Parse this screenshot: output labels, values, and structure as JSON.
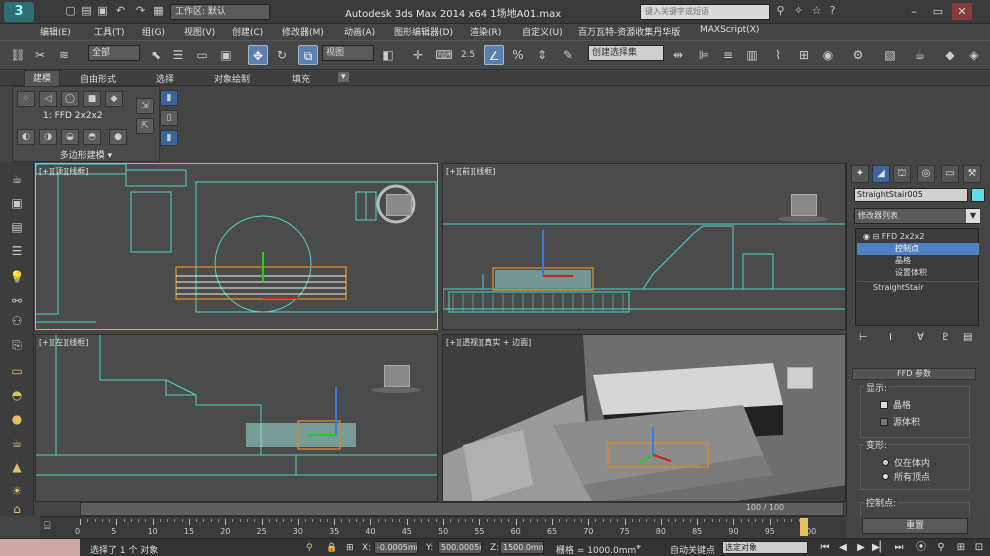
{
  "titlebar": {
    "logo": "3",
    "workspace": "工作区: 默认",
    "title": "Autodesk 3ds Max  2014 x64          1场地A01.max",
    "search_placeholder": "键入关键字或短语"
  },
  "menus": [
    "编辑(E)",
    "工具(T)",
    "组(G)",
    "视图(V)",
    "创建(C)",
    "修改器(M)",
    "动画(A)",
    "图形编辑器(D)",
    "渲染(R)",
    "自定义(U)",
    "百万瓦特-资源收集丹华版",
    "MAXScript(X)"
  ],
  "toolbar": {
    "selection_filter": "全部",
    "ref_coord": "视图",
    "snap_value": "2.5",
    "named_selection": "创建选择集"
  },
  "ribbon": {
    "tabs": [
      "建模",
      "自由形式",
      "选择",
      "对象绘制",
      "填充"
    ],
    "ffd_label": "1: FFD 2x2x2",
    "caption": "多边形建模"
  },
  "viewports": {
    "top": "[+][顶][线框]",
    "front": "[+][前][线框]",
    "left": "[+][左][线框]",
    "persp": "[+][透视][真实 + 边面]"
  },
  "command_panel": {
    "object_name": "StraightStair005",
    "object_color": "#66d9e8",
    "modifier_list": "修改器列表",
    "stack": [
      "FFD 2x2x2",
      "控制点",
      "晶格",
      "设置体积",
      "StraightStair"
    ],
    "rollout": "FFD 参数",
    "display_title": "显示:",
    "lattice": "晶格",
    "source_volume": "源体积",
    "deform_title": "变形:",
    "only_in_volume": "仅在体内",
    "all_vertices": "所有顶点",
    "control_points_title": "控制点:",
    "reset": "重置"
  },
  "timeline": {
    "frame_counter": "100 / 100",
    "ticks": [
      "0",
      "5",
      "10",
      "15",
      "20",
      "25",
      "30",
      "35",
      "40",
      "45",
      "50",
      "55",
      "60",
      "65",
      "70",
      "75",
      "80",
      "85",
      "90",
      "95",
      "100"
    ]
  },
  "status": {
    "message": "选择了 1 个 对象",
    "x_label": "X:",
    "x_value": "-0.0005mm",
    "y_label": "Y:",
    "y_value": "500.0005m",
    "z_label": "Z:",
    "z_value": "1500.0mm",
    "grid": "栅格 = 1000.0mm",
    "auto_key": "自动关键点",
    "selected_obj": "选定对象"
  }
}
